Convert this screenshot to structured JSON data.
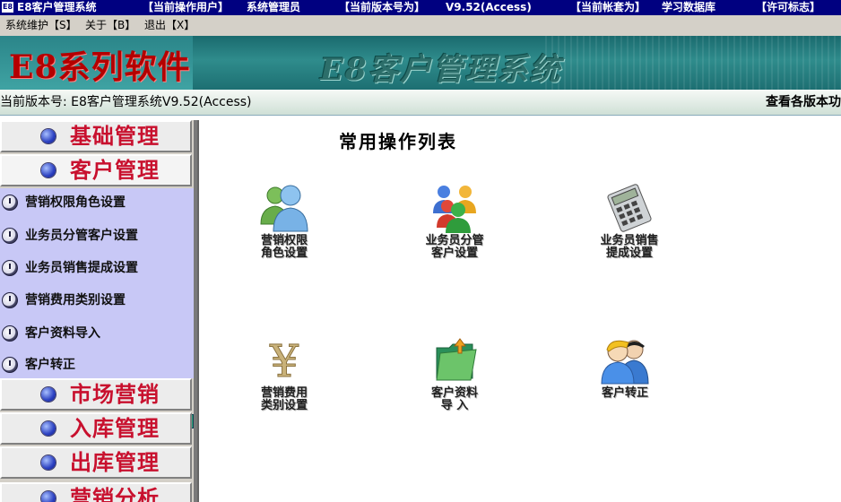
{
  "titlebar": {
    "app_icon": "E8",
    "app_name": "E8客户管理系统",
    "user_label": "【当前操作用户】",
    "user_value": "系统管理员",
    "version_label": "【当前版本号为】",
    "version_value": "V9.52(Access)",
    "account_label": "【当前帐套为】",
    "account_value": "学习数据库",
    "license_label": "【许可标志】"
  },
  "menubar": {
    "items": [
      "系统维护【S】",
      "关于【B】",
      "退出【X】"
    ]
  },
  "banner": {
    "logo": "E8系列软件",
    "system_name": "E8客户管理系统"
  },
  "version_strip": {
    "text": "当前版本号: E8客户管理系统V9.52(Access)",
    "link": "查看各版本功"
  },
  "sidebar": {
    "modules": [
      "基础管理",
      "客户管理",
      "市场营销",
      "入库管理",
      "出库管理",
      "营销分析"
    ],
    "active_module": "客户管理",
    "submenu": [
      "营销权限角色设置",
      "业务员分管客户设置",
      "业务员销售提成设置",
      "营销费用类别设置",
      "客户资料导入",
      "客户转正"
    ]
  },
  "main": {
    "heading": "常用操作列表",
    "operations": [
      {
        "label": "营销权限\n角色设置",
        "icon": "users-icon"
      },
      {
        "label": "业务员分管\n客户设置",
        "icon": "group-icon"
      },
      {
        "label": "业务员销售\n提成设置",
        "icon": "calculator-icon"
      },
      {
        "label": "营销费用\n类别设置",
        "icon": "yen-icon"
      },
      {
        "label": "客户资料\n导  入",
        "icon": "folder-import-icon"
      },
      {
        "label": "客户转正",
        "icon": "customer-convert-icon"
      }
    ]
  },
  "colors": {
    "titlebar": "#000080",
    "banner": "#2f8c8c",
    "logo": "#b40000",
    "module_label": "#c8102e",
    "submenu_bg": "#c8c8f6"
  }
}
